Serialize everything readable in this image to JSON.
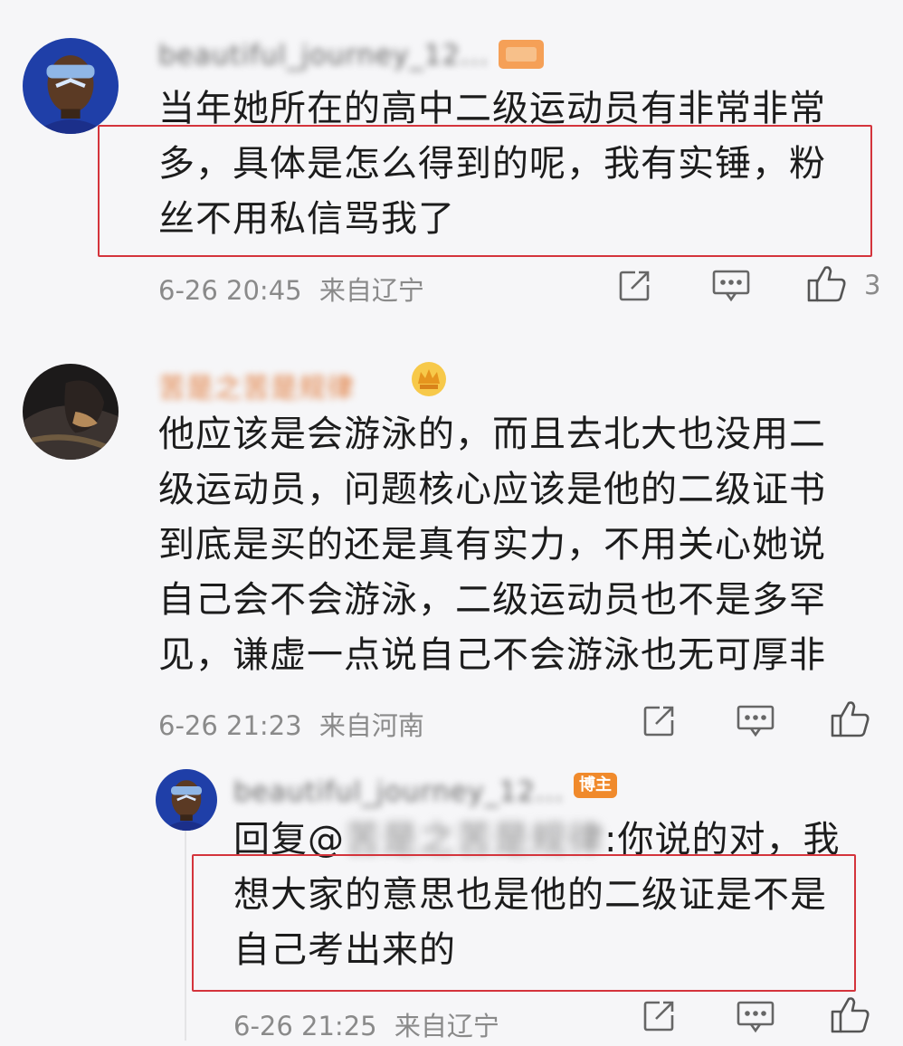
{
  "comments": [
    {
      "username": "beautiful_journey_12...",
      "lines": [
        "当年她所在的高中二级运动员有非常非常",
        "多，具体是怎么得到的呢，我有实锤，粉",
        "丝不用私信骂我了"
      ],
      "time": "6-26 20:45",
      "location": "来自辽宁",
      "likes": "3"
    },
    {
      "username": "苦是之苦是规律",
      "lines": [
        "他应该是会游泳的，而且去北大也没用二",
        "级运动员，问题核心应该是他的二级证书",
        "到底是买的还是真有实力，不用关心她说",
        "自己会不会游泳，二级运动员也不是多罕",
        "见，谦虚一点说自己不会游泳也无可厚非"
      ],
      "time": "6-26 21:23",
      "location": "来自河南"
    },
    {
      "username": "beautiful_journey_12...",
      "host_badge": "博主",
      "reply_prefix": "回复@",
      "mention": "苦是之苦是规律",
      "lines": [
        ":你说的对，我",
        "想大家的意思也是他的二级证是不是",
        "自己考出来的"
      ],
      "time": "6-26 21:25",
      "location": "来自辽宁"
    }
  ],
  "icons": {
    "share": "share-icon",
    "comment": "comment-icon",
    "like": "thumbs-up-icon"
  },
  "colors": {
    "highlight_box": "#d4343c",
    "meta_text": "#8a8a8a",
    "host_badge": "#f08a2c"
  }
}
